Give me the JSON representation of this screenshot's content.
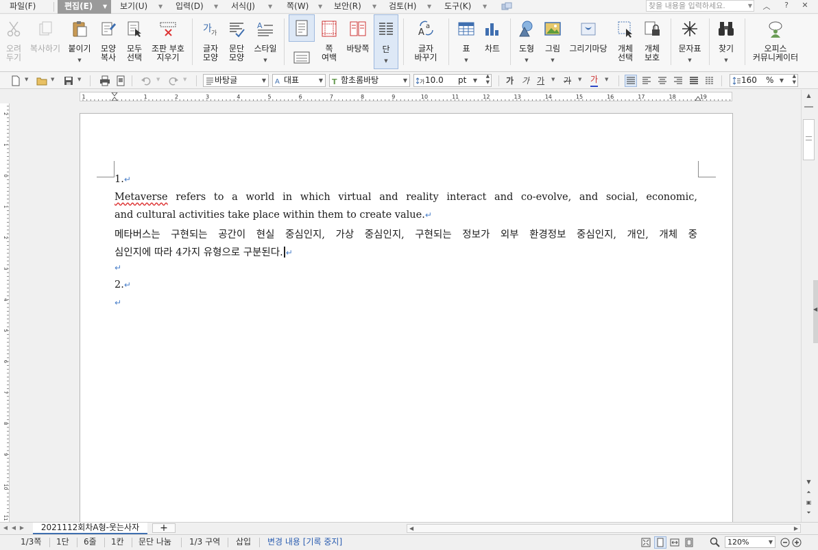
{
  "menu": {
    "items": [
      {
        "label": "파일(F)"
      },
      {
        "label": "편집(E)",
        "active": true
      },
      {
        "label": "보기(U)"
      },
      {
        "label": "입력(D)"
      },
      {
        "label": "서식(J)"
      },
      {
        "label": "쪽(W)"
      },
      {
        "label": "보안(R)"
      },
      {
        "label": "검토(H)"
      },
      {
        "label": "도구(K)"
      }
    ],
    "search_placeholder": "찾을 내용을 입력하세요.",
    "controls": [
      "︿",
      "?",
      "✕"
    ]
  },
  "ribbon": {
    "buttons": {
      "cut": "오려\n두기",
      "copy": "복사하기",
      "paste": "붙이기",
      "format_copy": "모양\n복사",
      "select_all": "모두\n선택",
      "remove_markup": "조판 부호\n지우기",
      "char_shape": "글자\n모양",
      "para_shape": "문단\n모양",
      "style": "스타일",
      "page_margin": "쪽\n여백",
      "page_bg": "바탕쪽",
      "columns": "단",
      "replace": "글자\n바꾸기",
      "table": "표",
      "chart": "차트",
      "shape": "도형",
      "picture": "그림",
      "draw_market": "그리기마당",
      "obj_select": "개체\n선택",
      "obj_protect": "개체\n보호",
      "symbols": "문자표",
      "find": "찾기",
      "community": "오피스\n커뮤니케이터"
    }
  },
  "format_toolbar": {
    "style_combo": "바탕글",
    "lang_combo": "대표",
    "font_combo": "함초롬바탕",
    "font_size": "10.0",
    "font_unit": "pt",
    "char_buttons": [
      "가",
      "가",
      "가",
      "가",
      "가"
    ],
    "spacing_value": "160",
    "spacing_unit": "%"
  },
  "ruler": {
    "ticks": [
      "1",
      "1",
      "2",
      "3",
      "4",
      "5",
      "6",
      "7",
      "8",
      "9",
      "10",
      "11",
      "12",
      "13",
      "14",
      "15",
      "16",
      "17",
      "18",
      "19"
    ],
    "vticks": [
      "2",
      "1",
      "0",
      "1",
      "2",
      "3",
      "4",
      "5",
      "6",
      "7",
      "8",
      "9",
      "10",
      "11"
    ]
  },
  "document": {
    "para_mark": "↵",
    "lines": [
      {
        "text": "1."
      },
      {
        "text_pre": "Metaverse",
        "text": " refers to a world in which virtual and reality interact and co-evolve, and social, economic,"
      },
      {
        "text": "and cultural activities take place within them to create value."
      },
      {
        "text": "메타버스는 구현되는 공간이 현실 중심인지, 가상 중심인지, 구현되는 정보가 외부 환경정보 중심인지, 개인, 개체 중"
      },
      {
        "text": "심인지에 따라 4가지 유형으로 구분된다."
      },
      {
        "text": ""
      },
      {
        "text": "2."
      },
      {
        "text": ""
      }
    ]
  },
  "tabs": {
    "document_tab": "2021112회차A형-웃는사자",
    "add_label": "+"
  },
  "status": {
    "page": "1/3쪽",
    "column": "1단",
    "line": "6줄",
    "cell": "1칸",
    "para_break": "문단 나눔",
    "section": "1/3 구역",
    "insert_mode": "삽입",
    "track_changes": "변경 내용 [기록 중지]",
    "zoom": "120%"
  },
  "colors": {
    "accent": "#3f6fb0",
    "para_mark": "#4a7fc9",
    "active_menu": "#9a9a9a"
  }
}
